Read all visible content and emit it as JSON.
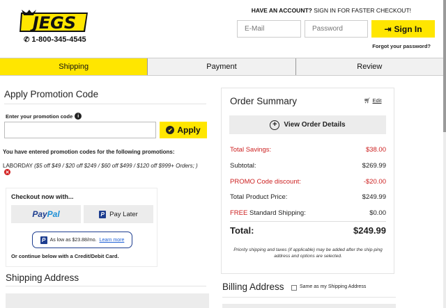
{
  "header": {
    "brand": "JEGS",
    "phone": "1-800-345-4545",
    "account_prompt_bold": "HAVE AN ACCOUNT?",
    "account_prompt_rest": " SIGN IN FOR FASTER CHECKOUT!",
    "email_placeholder": "E-Mail",
    "password_placeholder": "Password",
    "signin_label": "Sign In",
    "forgot_label": "Forgot your password?",
    "brand_color": "#ffe600"
  },
  "steps": [
    {
      "label": "Shipping",
      "active": true
    },
    {
      "label": "Payment",
      "active": false
    },
    {
      "label": "Review",
      "active": false
    }
  ],
  "promo": {
    "title": "Apply Promotion Code",
    "input_label": "Enter your promotion code",
    "apply_label": "Apply",
    "entered_text": "You have entered promotion codes for the following promotions:",
    "code": "LABORDAY",
    "code_detail": "($5 off $49 / $20 off $249 / $60 off $499 / $120 off $999+ Orders; )"
  },
  "checkout": {
    "title": "Checkout now with...",
    "paypal_part1": "Pay",
    "paypal_part2": "Pal",
    "paylater_label": "Pay Later",
    "as_low_as": "As low as $23.88/mo.",
    "learn_more": "Learn more",
    "or_continue": "Or continue below with a Credit/Debit Card."
  },
  "shipping_address": {
    "title": "Shipping Address"
  },
  "summary": {
    "title": "Order Summary",
    "edit_label": "Edit",
    "view_details_label": "View Order Details",
    "rows": [
      {
        "label": "Total Savings:",
        "value": "$38.00",
        "highlight": true
      },
      {
        "label": "Subtotal:",
        "value": "$269.99",
        "highlight": false
      },
      {
        "label": "PROMO Code discount:",
        "value": "-$20.00",
        "highlight": true
      },
      {
        "label": "Total Product Price:",
        "value": "$249.99",
        "highlight": false
      }
    ],
    "shipping_free": "FREE",
    "shipping_label": " Standard Shipping:",
    "shipping_value": "$0.00",
    "total_label": "Total:",
    "total_value": "$249.99",
    "note": "Priority shipping and taxes (if applicable) may be added after the ship-ping address and options are selected."
  },
  "billing": {
    "title": "Billing Address",
    "same_label": "Same as my Shipping Address"
  }
}
